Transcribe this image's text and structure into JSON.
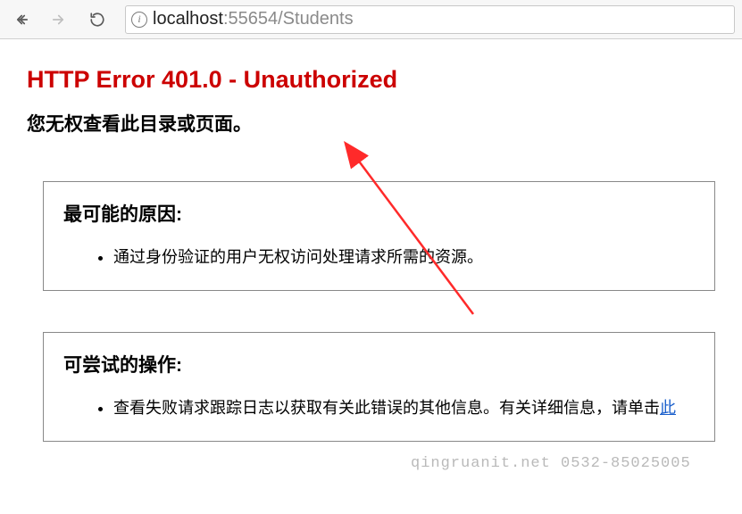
{
  "browser": {
    "url_host": "localhost",
    "url_port": ":55654",
    "url_path": "/Students"
  },
  "error": {
    "title": "HTTP Error 401.0 - Unauthorized",
    "subtitle": "您无权查看此目录或页面。"
  },
  "section_causes": {
    "heading": "最可能的原因:",
    "items": [
      "通过身份验证的用户无权访问处理请求所需的资源。"
    ]
  },
  "section_actions": {
    "heading": "可尝试的操作:",
    "items_prefix": "查看失败请求跟踪日志以获取有关此错误的其他信息。有关详细信息，请单击",
    "items_link": "此"
  },
  "watermark": "qingruanit.net 0532-85025005"
}
